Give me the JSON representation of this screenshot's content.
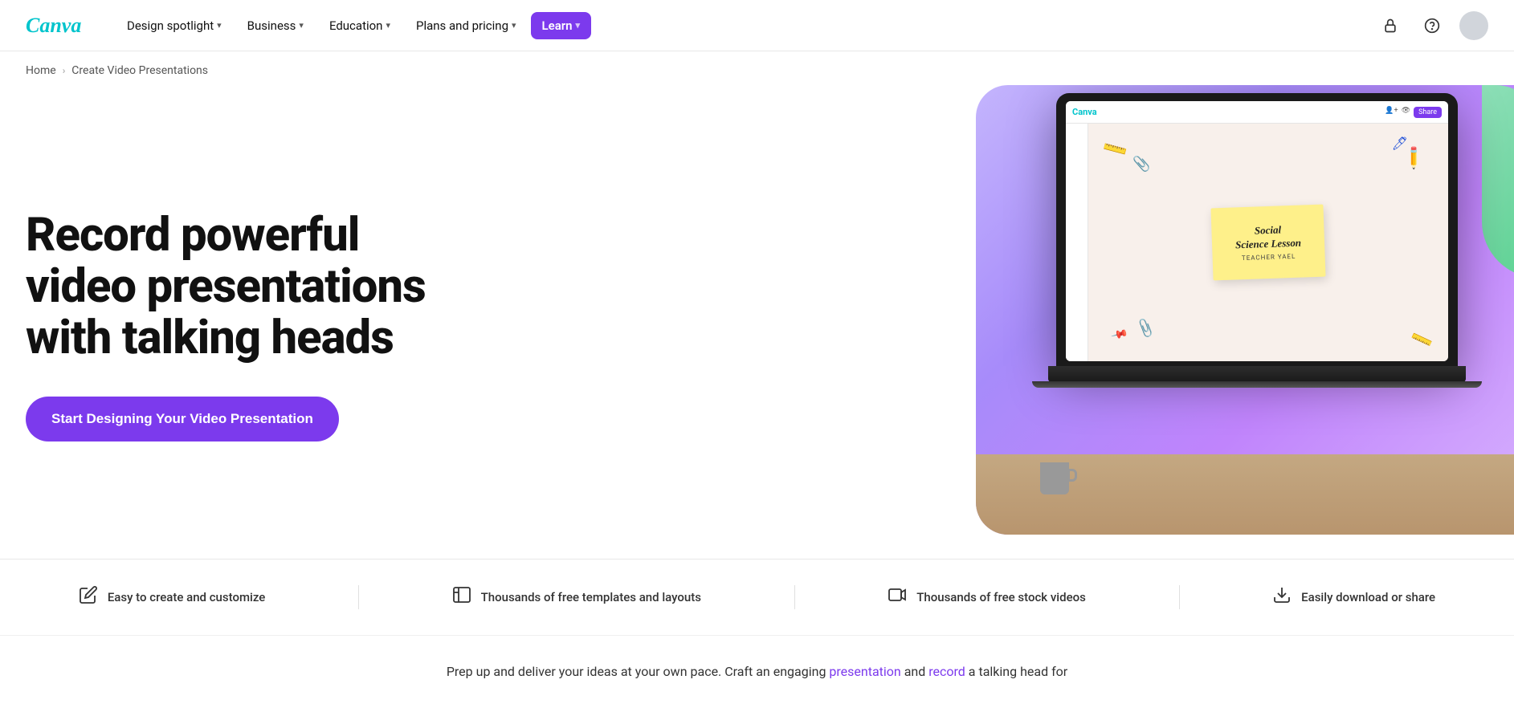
{
  "brand": {
    "name": "Canva",
    "logo_color": "#00c4cc"
  },
  "nav": {
    "items": [
      {
        "label": "Design spotlight",
        "has_dropdown": true,
        "active": false
      },
      {
        "label": "Business",
        "has_dropdown": true,
        "active": false
      },
      {
        "label": "Education",
        "has_dropdown": true,
        "active": false
      },
      {
        "label": "Plans and pricing",
        "has_dropdown": true,
        "active": false
      },
      {
        "label": "Learn",
        "has_dropdown": true,
        "active": true
      }
    ],
    "icons": {
      "lock_label": "⊙",
      "help_label": "?"
    }
  },
  "breadcrumb": {
    "home_label": "Home",
    "separator": "›",
    "current": "Create Video Presentations"
  },
  "hero": {
    "title_line1": "Record powerful",
    "title_line2": "video presentations",
    "title_line3": "with talking heads",
    "cta_label": "Start Designing Your Video Presentation"
  },
  "laptop_screen": {
    "canva_logo": "Canva",
    "share_btn": "Share",
    "slide_title_line1": "Social",
    "slide_title_line2": "Science Lesson",
    "slide_subtitle": "TEACHER YAEL"
  },
  "features": [
    {
      "icon": "✏️",
      "text": "Easy to create and customize"
    },
    {
      "icon": "⊞",
      "text": "Thousands of free templates and layouts"
    },
    {
      "icon": "▶",
      "text": "Thousands of free stock videos"
    },
    {
      "icon": "⬇",
      "text": "Easily download or share"
    }
  ],
  "bottom_text": {
    "before": "Prep up and deliver your ideas at your own pace. Craft an engaging",
    "link1_label": "presentation",
    "middle": "and",
    "link2_label": "record",
    "after": "a talking head for"
  }
}
